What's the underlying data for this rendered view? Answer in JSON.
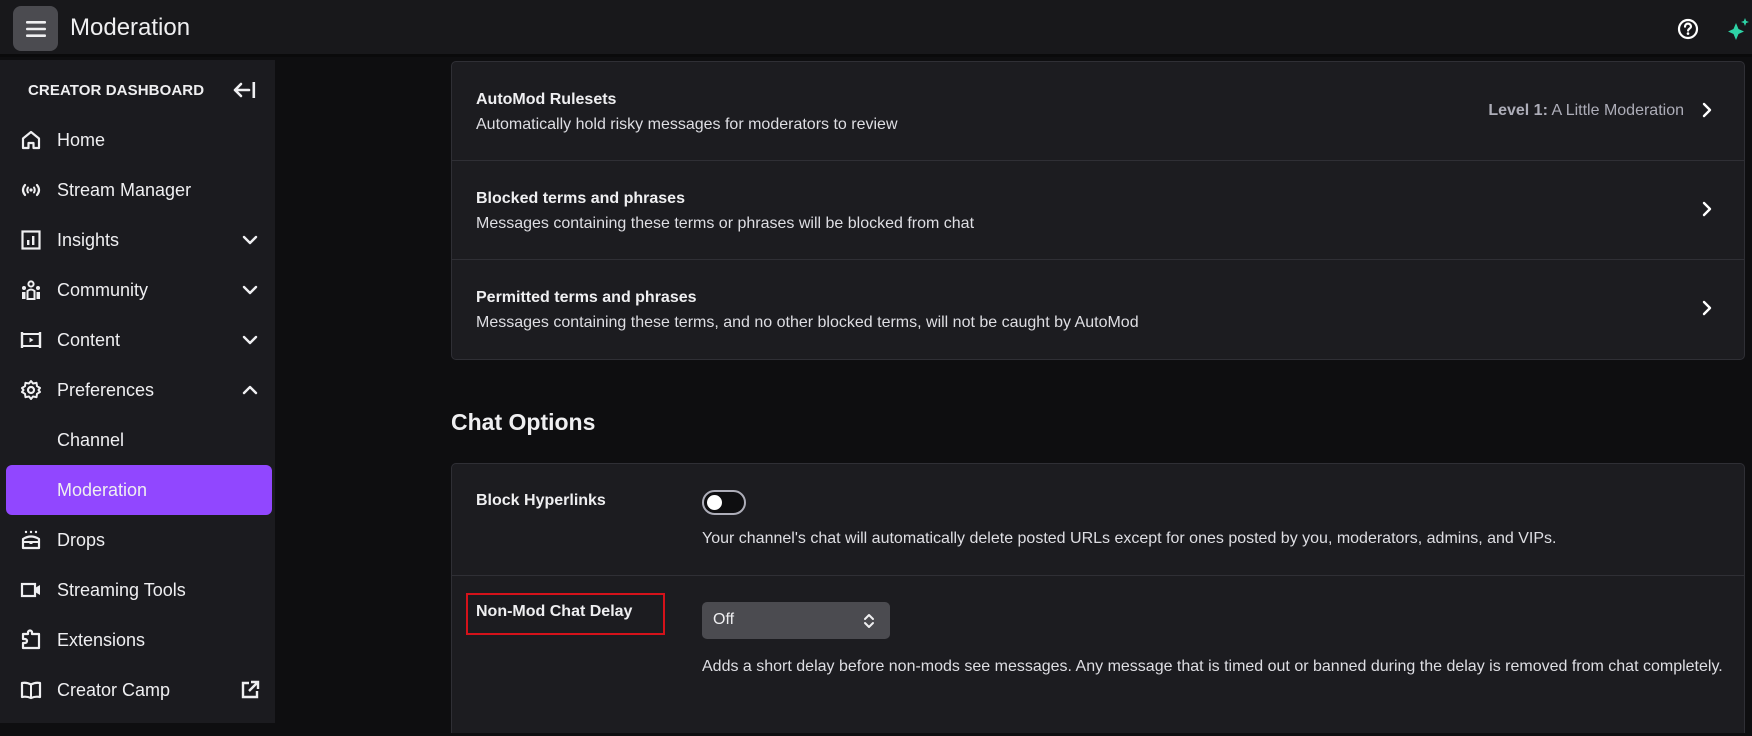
{
  "header": {
    "title": "Moderation",
    "menu_icon": "hamburger-icon",
    "help_icon": "help-icon",
    "sparkle_icon": "sparkle-icon",
    "sparkle_color": "#2ed3a6"
  },
  "sidebar": {
    "title": "CREATOR DASHBOARD",
    "collapse_icon": "collapse-left-icon",
    "active_color": "#9147ff",
    "items": [
      {
        "label": "Home",
        "icon": "home-icon"
      },
      {
        "label": "Stream Manager",
        "icon": "broadcast-icon"
      },
      {
        "label": "Insights",
        "icon": "chart-icon",
        "expand": "down"
      },
      {
        "label": "Community",
        "icon": "community-icon",
        "expand": "down"
      },
      {
        "label": "Content",
        "icon": "video-icon",
        "expand": "down"
      },
      {
        "label": "Preferences",
        "icon": "gear-icon",
        "expand": "up"
      },
      {
        "label": "Channel",
        "sub": true
      },
      {
        "label": "Moderation",
        "sub": true,
        "active": true
      },
      {
        "label": "Drops",
        "icon": "drops-icon"
      },
      {
        "label": "Streaming Tools",
        "icon": "camera-icon"
      },
      {
        "label": "Extensions",
        "icon": "puzzle-icon"
      },
      {
        "label": "Creator Camp",
        "icon": "book-icon",
        "external": true
      }
    ]
  },
  "automod": {
    "rows": [
      {
        "title": "AutoMod Rulesets",
        "description": "Automatically hold risky messages for moderators to review",
        "value_bold": "Level 1:",
        "value": "A Little Moderation"
      },
      {
        "title": "Blocked terms and phrases",
        "description": "Messages containing these terms or phrases will be blocked from chat"
      },
      {
        "title": "Permitted terms and phrases",
        "description": "Messages containing these terms, and no other blocked terms, will not be caught by AutoMod"
      }
    ]
  },
  "chat_options": {
    "heading": "Chat Options",
    "block_hyperlinks": {
      "label": "Block Hyperlinks",
      "enabled": false,
      "description": "Your channel's chat will automatically delete posted URLs except for ones posted by you, moderators, admins, and VIPs."
    },
    "non_mod_delay": {
      "label": "Non-Mod Chat Delay",
      "selected": "Off",
      "description": "Adds a short delay before non-mods see messages. Any message that is timed out or banned during the delay is removed from chat completely.",
      "highlight_color": "#d4121a"
    }
  }
}
